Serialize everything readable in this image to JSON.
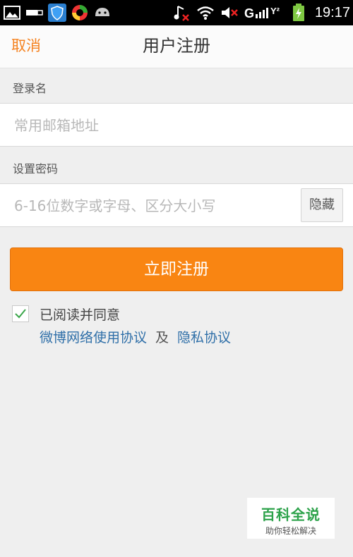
{
  "status_bar": {
    "time": "19:17",
    "icons": [
      "gallery-icon",
      "usb-icon",
      "shield-icon",
      "app-icon",
      "android-icon",
      "music-off-icon",
      "wifi-icon",
      "mute-icon",
      "signal-icon",
      "battery-charging-icon"
    ]
  },
  "header": {
    "cancel_label": "取消",
    "title": "用户注册"
  },
  "form": {
    "username_label": "登录名",
    "username_placeholder": "常用邮箱地址",
    "password_label": "设置密码",
    "password_placeholder": "6-16位数字或字母、区分大小写",
    "hide_label": "隐藏",
    "register_label": "立即注册",
    "agree_checked": true,
    "agree_label": "已阅读并同意",
    "terms_link": "微博网络使用协议",
    "and_text": "及",
    "privacy_link": "隐私协议"
  },
  "watermark": {
    "main": "百科全说",
    "sub": "助你轻松解决"
  },
  "colors": {
    "accent": "#f98512",
    "link": "#2f6fa8",
    "background": "#efefef"
  }
}
